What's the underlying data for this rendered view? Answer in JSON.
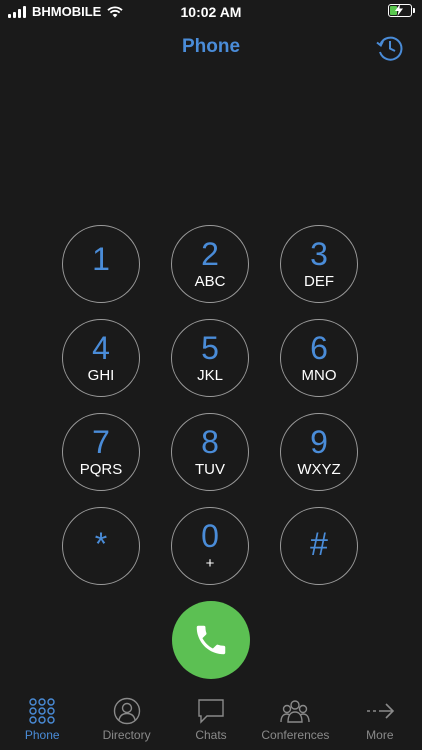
{
  "status": {
    "carrier": "BHMOBILE",
    "time": "10:02 AM"
  },
  "header": {
    "title": "Phone",
    "history_icon": "history-icon"
  },
  "keypad": [
    {
      "digit": "1",
      "letters": ""
    },
    {
      "digit": "2",
      "letters": "ABC"
    },
    {
      "digit": "3",
      "letters": "DEF"
    },
    {
      "digit": "4",
      "letters": "GHI"
    },
    {
      "digit": "5",
      "letters": "JKL"
    },
    {
      "digit": "6",
      "letters": "MNO"
    },
    {
      "digit": "7",
      "letters": "PQRS"
    },
    {
      "digit": "8",
      "letters": "TUV"
    },
    {
      "digit": "9",
      "letters": "WXYZ"
    },
    {
      "digit": "*",
      "letters": ""
    },
    {
      "digit": "0",
      "letters": "+"
    },
    {
      "digit": "#",
      "letters": ""
    }
  ],
  "call_button": {
    "icon": "phone-icon",
    "color": "#5cc053"
  },
  "tabs": [
    {
      "label": "Phone",
      "icon": "keypad-grid-icon",
      "active": true
    },
    {
      "label": "Directory",
      "icon": "person-icon",
      "active": false
    },
    {
      "label": "Chats",
      "icon": "chat-bubble-icon",
      "active": false
    },
    {
      "label": "Conferences",
      "icon": "group-icon",
      "active": false
    },
    {
      "label": "More",
      "icon": "arrow-right-icon",
      "active": false
    }
  ],
  "colors": {
    "accent": "#4a8cd8",
    "background": "#1a1a1a",
    "call_green": "#5cc053"
  }
}
